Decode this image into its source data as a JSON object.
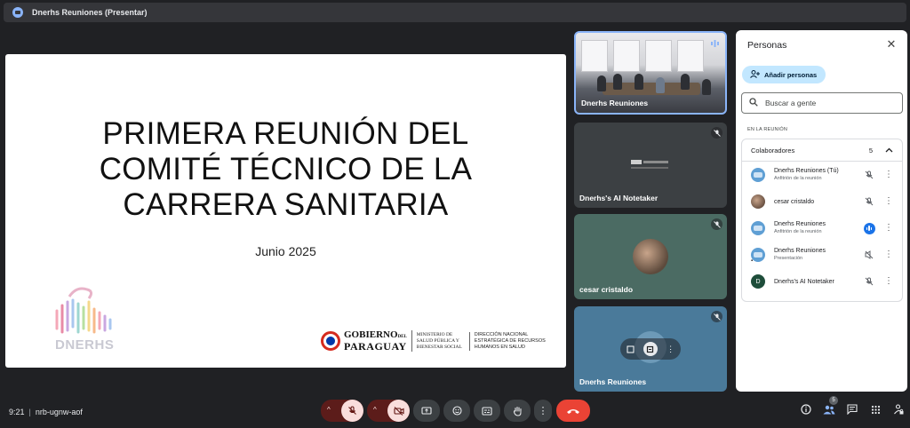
{
  "window": {
    "title": "Dnerhs Reuniones (Presentar)"
  },
  "slide": {
    "heading": "PRIMERA REUNIÓN DEL\nCOMITÉ  TÉCNICO DE LA\nCARRERA SANITARIA",
    "date": "Junio 2025",
    "logo_word": "DNERHS",
    "gov_line1": "GOBIERNO",
    "gov_del": "DEL",
    "gov_line2": "PARAGUAY",
    "ministerio": "MINISTERIO DE\nSALUD PÚBLICA Y\nBIENESTAR SOCIAL",
    "direccion": "DIRECCIÓN NACIONAL\nESTRATÉGICA DE RECURSOS\nHUMANOS EN SALUD"
  },
  "tiles": [
    {
      "name": "Dnerhs Reuniones"
    },
    {
      "name": "Dnerhs's AI Notetaker"
    },
    {
      "name": "cesar cristaldo"
    },
    {
      "name": "Dnerhs Reuniones"
    }
  ],
  "panel": {
    "title": "Personas",
    "add_label": "Añadir personas",
    "search_placeholder": "Buscar a gente",
    "section_label": "EN LA REUNIÓN",
    "group_label": "Colaboradores",
    "group_count": "5",
    "participants": [
      {
        "name": "Dnerhs Reuniones (Tú)",
        "sub": "Anfitrión de la reunión",
        "mic": "muted"
      },
      {
        "name": "cesar cristaldo",
        "sub": "",
        "mic": "muted"
      },
      {
        "name": "Dnerhs Reuniones",
        "sub": "Anfitrión de la reunión",
        "mic": "speaking"
      },
      {
        "name": "Dnerhs Reuniones",
        "sub": "Presentación",
        "mic": "muted-presenting"
      },
      {
        "name": "Dnerhs's AI Notetaker",
        "sub": "",
        "mic": "muted",
        "avatar_letter": "D"
      }
    ]
  },
  "bottom": {
    "time": "9:21",
    "meeting_code": "nrb-ugnw-aof",
    "people_badge": "5"
  },
  "colors": {
    "accent": "#8ab4f8",
    "end_call": "#ea4335",
    "muted_bg": "#f9dedc"
  }
}
